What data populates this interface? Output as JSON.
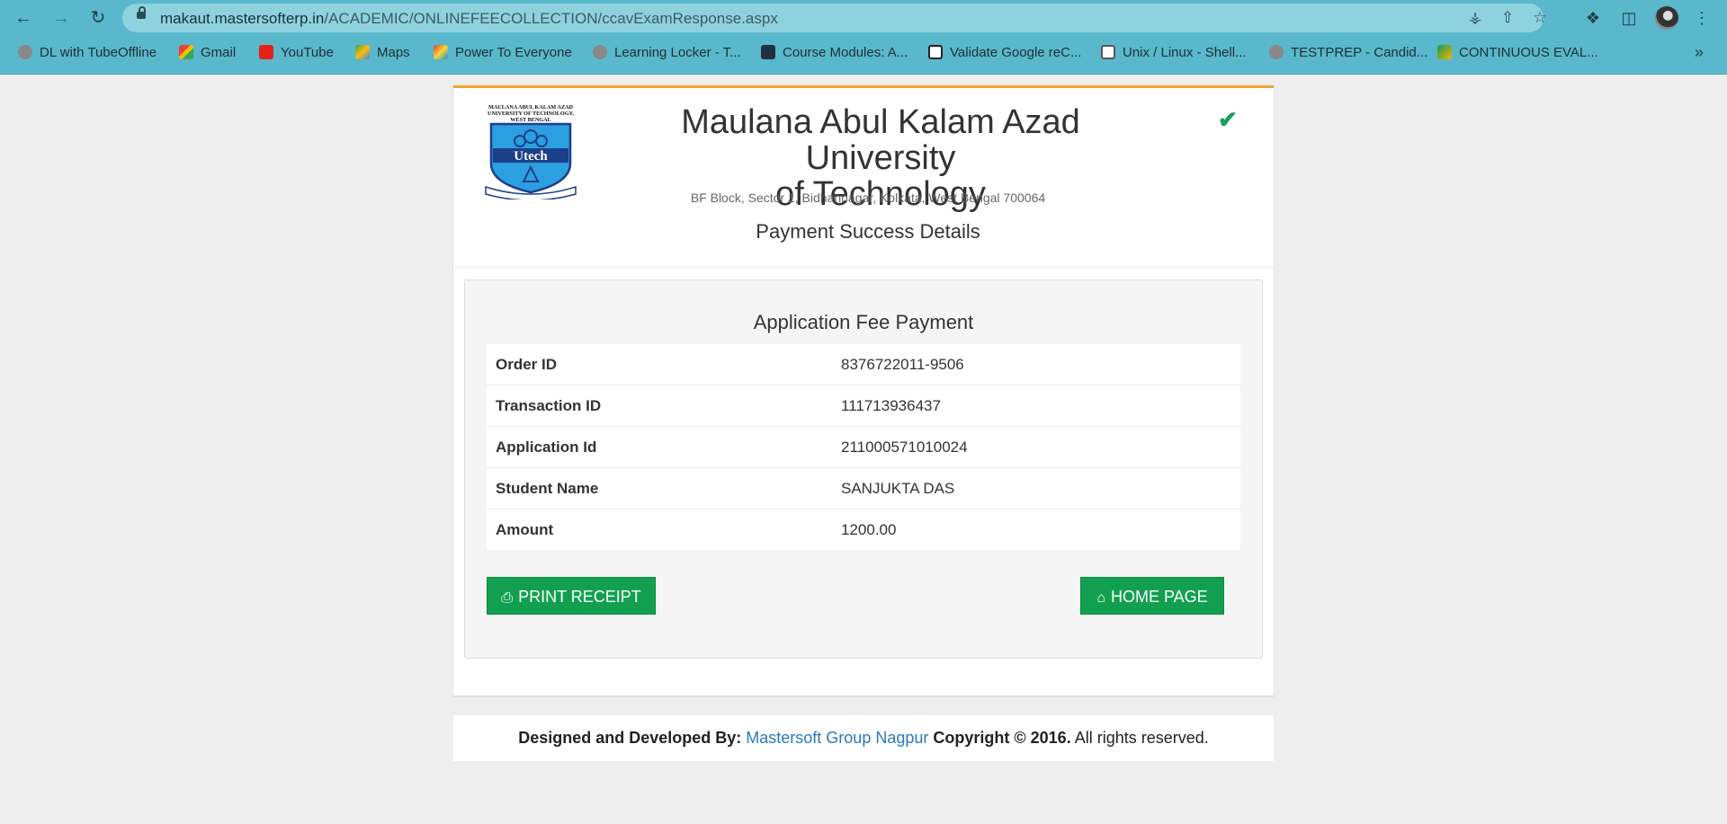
{
  "browser": {
    "url_domain": "makaut.mastersofterp.in",
    "url_path": "/ACADEMIC/ONLINEFEECOLLECTION/ccavExamResponse.aspx",
    "bookmarks": [
      {
        "label": "DL with TubeOffline",
        "icon": "globe-icon"
      },
      {
        "label": "Gmail",
        "icon": "gmail-icon"
      },
      {
        "label": "YouTube",
        "icon": "youtube-icon"
      },
      {
        "label": "Maps",
        "icon": "maps-icon"
      },
      {
        "label": "Power To Everyone",
        "icon": "pte-icon"
      },
      {
        "label": "Learning Locker - T...",
        "icon": "globe-icon"
      },
      {
        "label": "Course Modules: A...",
        "icon": "aws-icon"
      },
      {
        "label": "Validate Google reC...",
        "icon": "recaptcha-icon"
      },
      {
        "label": "Unix / Linux - Shell...",
        "icon": "tutorials-icon"
      },
      {
        "label": "TESTPREP - Candid...",
        "icon": "globe-icon"
      },
      {
        "label": "CONTINUOUS EVAL...",
        "icon": "classroom-icon"
      }
    ]
  },
  "header": {
    "university_line1": "Maulana Abul Kalam Azad University",
    "university_line2": "of Technology",
    "address": "BF Block, Sector 1, Bidhannagar, Kolkata, West Bengal 700064",
    "subtitle": "Payment Success Details",
    "logo_top_text": "MAULANA ABUL KALAM AZAD UNIVERSITY OF TECHNOLOGY, WEST BENGAL",
    "logo_word": "Utech",
    "logo_motto": "In Pursuit of Knowledge And Excellence"
  },
  "payment": {
    "title": "Application Fee Payment",
    "rows": [
      {
        "label": "Order ID",
        "value": "8376722011-9506"
      },
      {
        "label": "Transaction ID",
        "value": "111713936437"
      },
      {
        "label": "Application Id",
        "value": "211000571010024"
      },
      {
        "label": "Student Name",
        "value": "SANJUKTA DAS"
      },
      {
        "label": "Amount",
        "value": "1200.00"
      }
    ],
    "print_label": "PRINT RECEIPT",
    "home_label": "HOME PAGE"
  },
  "footer": {
    "designed_by": "Designed and Developed By:",
    "company": "Mastersoft Group Nagpur",
    "copyright": "Copyright © 2016.",
    "rights": "All rights reserved."
  },
  "colors": {
    "chrome": "#5ab8cc",
    "accent_bar": "#f0a330",
    "button": "#12a050",
    "link": "#2a79b8",
    "success": "#16a05a"
  }
}
